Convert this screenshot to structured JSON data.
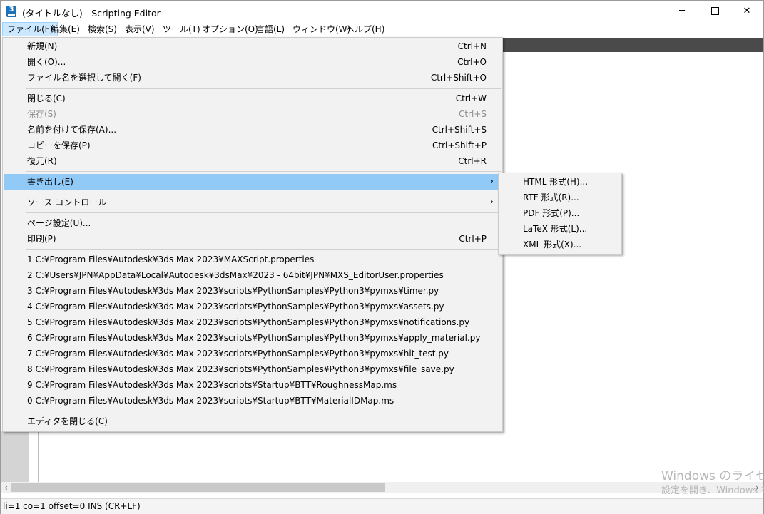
{
  "window": {
    "title": "(タイトルなし) - Scripting Editor",
    "icon_label": "3",
    "controls": {
      "minimize": "─",
      "close": "✕"
    }
  },
  "menubar": [
    {
      "id": "file",
      "label": "ファイル(F)",
      "active": true
    },
    {
      "id": "edit",
      "label": "編集(E)"
    },
    {
      "id": "search",
      "label": "検索(S)"
    },
    {
      "id": "view",
      "label": "表示(V)"
    },
    {
      "id": "tools",
      "label": "ツール(T)"
    },
    {
      "id": "options",
      "label": "オプション(O)"
    },
    {
      "id": "language",
      "label": "言語(L)"
    },
    {
      "id": "window",
      "label": "ウィンドウ(W)"
    },
    {
      "id": "help",
      "label": "ヘルプ(H)"
    }
  ],
  "file_menu": {
    "new": {
      "label": "新規(N)",
      "shortcut": "Ctrl+N"
    },
    "open": {
      "label": "開く(O)...",
      "shortcut": "Ctrl+O"
    },
    "open_named": {
      "label": "ファイル名を選択して開く(F)",
      "shortcut": "Ctrl+Shift+O"
    },
    "close": {
      "label": "閉じる(C)",
      "shortcut": "Ctrl+W"
    },
    "save": {
      "label": "保存(S)",
      "shortcut": "Ctrl+S",
      "disabled": true
    },
    "save_as": {
      "label": "名前を付けて保存(A)...",
      "shortcut": "Ctrl+Shift+S"
    },
    "save_copy": {
      "label": "コピーを保存(P)",
      "shortcut": "Ctrl+Shift+P"
    },
    "revert": {
      "label": "復元(R)",
      "shortcut": "Ctrl+R"
    },
    "export": {
      "label": "書き出し(E)",
      "arrow": "›",
      "highlighted": true
    },
    "source_control": {
      "label": "ソース コントロール",
      "arrow": "›"
    },
    "page_setup": {
      "label": "ページ設定(U)..."
    },
    "print": {
      "label": "印刷(P)",
      "shortcut": "Ctrl+P"
    },
    "recent": [
      "1 C:¥Program Files¥Autodesk¥3ds Max 2023¥MAXScript.properties",
      "2 C:¥Users¥JPN¥AppData¥Local¥Autodesk¥3dsMax¥2023 - 64bit¥JPN¥MXS_EditorUser.properties",
      "3 C:¥Program Files¥Autodesk¥3ds Max 2023¥scripts¥PythonSamples¥Python3¥pymxs¥timer.py",
      "4 C:¥Program Files¥Autodesk¥3ds Max 2023¥scripts¥PythonSamples¥Python3¥pymxs¥assets.py",
      "5 C:¥Program Files¥Autodesk¥3ds Max 2023¥scripts¥PythonSamples¥Python3¥pymxs¥notifications.py",
      "6 C:¥Program Files¥Autodesk¥3ds Max 2023¥scripts¥PythonSamples¥Python3¥pymxs¥apply_material.py",
      "7 C:¥Program Files¥Autodesk¥3ds Max 2023¥scripts¥PythonSamples¥Python3¥pymxs¥hit_test.py",
      "8 C:¥Program Files¥Autodesk¥3ds Max 2023¥scripts¥PythonSamples¥Python3¥pymxs¥file_save.py",
      "9 C:¥Program Files¥Autodesk¥3ds Max 2023¥scripts¥Startup¥BTT¥RoughnessMap.ms",
      "0 C:¥Program Files¥Autodesk¥3ds Max 2023¥scripts¥Startup¥BTT¥MaterialIDMap.ms"
    ],
    "exit": {
      "label": "エディタを閉じる(C)"
    }
  },
  "export_submenu": [
    "HTML 形式(H)...",
    "RTF 形式(R)...",
    "PDF 形式(P)...",
    "LaTeX 形式(L)...",
    "XML 形式(X)..."
  ],
  "scrollbar": {
    "left_arrow": "‹",
    "right_arrow": "›"
  },
  "status": "li=1 co=1 offset=0 INS (CR+LF)",
  "watermark": {
    "line1": "Windows のライセ",
    "line2": "設定を開き、Windows を"
  },
  "colors": {
    "menu_bg": "#f2f2f2",
    "highlight": "#91c9f7",
    "menubar_active": "#cce8ff",
    "tabstrip": "#4a4a4a",
    "gutter": "#d4d4d4"
  }
}
